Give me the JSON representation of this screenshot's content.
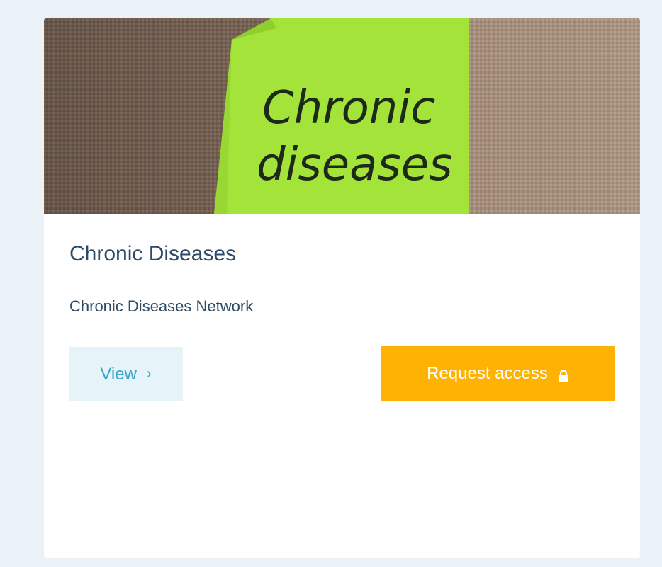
{
  "card": {
    "title": "Chronic Diseases",
    "subtitle": "Chronic Diseases Network",
    "image": {
      "note_line1": "Chronic",
      "note_line2": "diseases",
      "note_color": "#a4e33a",
      "background_color": "#8a7565"
    },
    "buttons": {
      "view_label": "View",
      "view_icon": "chevron-right-icon",
      "request_label": "Request access",
      "request_icon": "lock-icon"
    }
  },
  "colors": {
    "page_background": "#eaf2f8",
    "title": "#2d4a66",
    "view_button_bg": "#e6f4fa",
    "view_button_text": "#3aa4c9",
    "request_button_bg": "#fdb204",
    "request_button_text": "#ffffff"
  }
}
